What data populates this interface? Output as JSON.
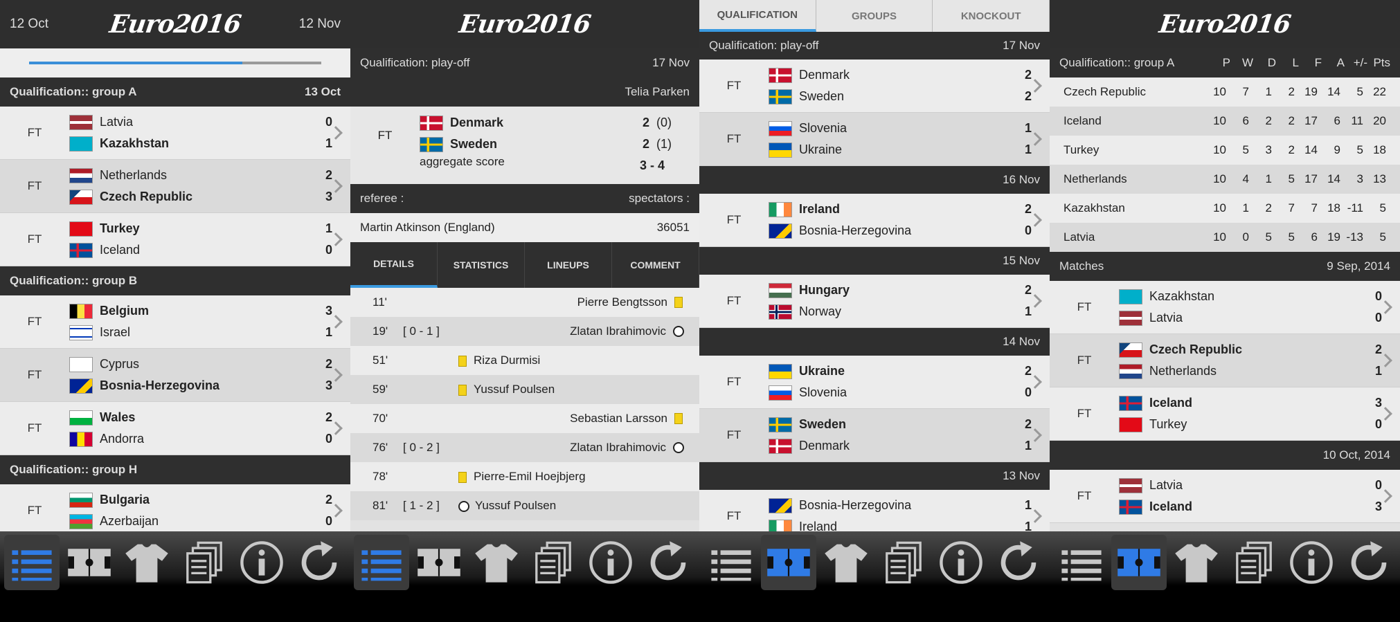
{
  "app": {
    "title": "Euro2016"
  },
  "colors": {
    "accent": "#3a9ae0",
    "active_icon": "#2f7be6",
    "icon": "#c8c8c8",
    "dark": "#2f2f2f"
  },
  "panel1": {
    "prev_date": "12 Oct",
    "next_date": "12 Nov",
    "progress": 0.73,
    "sections": [
      {
        "title": "Qualification:: group A",
        "date": "13 Oct",
        "matches": [
          {
            "status": "FT",
            "home": "Latvia",
            "away": "Kazakhstan",
            "hs": "0",
            "as": "1",
            "winner": "away",
            "hflag": "latvia",
            "aflag": "kazakhstan"
          },
          {
            "status": "FT",
            "home": "Netherlands",
            "away": "Czech Republic",
            "hs": "2",
            "as": "3",
            "winner": "away",
            "hflag": "netherlands",
            "aflag": "czech"
          },
          {
            "status": "FT",
            "home": "Turkey",
            "away": "Iceland",
            "hs": "1",
            "as": "0",
            "winner": "home",
            "hflag": "turkey",
            "aflag": "iceland"
          }
        ]
      },
      {
        "title": "Qualification:: group B",
        "date": "",
        "matches": [
          {
            "status": "FT",
            "home": "Belgium",
            "away": "Israel",
            "hs": "3",
            "as": "1",
            "winner": "home",
            "hflag": "belgium",
            "aflag": "israel"
          },
          {
            "status": "FT",
            "home": "Cyprus",
            "away": "Bosnia-Herzegovina",
            "hs": "2",
            "as": "3",
            "winner": "away",
            "hflag": "cyprus",
            "aflag": "bosnia"
          },
          {
            "status": "FT",
            "home": "Wales",
            "away": "Andorra",
            "hs": "2",
            "as": "0",
            "winner": "home",
            "hflag": "wales",
            "aflag": "andorra"
          }
        ]
      },
      {
        "title": "Qualification:: group H",
        "date": "",
        "matches": [
          {
            "status": "FT",
            "home": "Bulgaria",
            "away": "Azerbaijan",
            "hs": "2",
            "as": "0",
            "winner": "home",
            "hflag": "bulgaria",
            "aflag": "azerbaijan"
          }
        ]
      }
    ]
  },
  "panel2": {
    "competition": "Qualification: play-off",
    "date": "17 Nov",
    "venue": "Telia Parken",
    "status": "FT",
    "home": "Denmark",
    "away": "Sweden",
    "hs": "2",
    "hs_pen": "(0)",
    "as": "2",
    "as_pen": "(1)",
    "agg_label": "aggregate score",
    "agg_value": "3 - 4",
    "referee_label": "referee :",
    "spectators_label": "spectators :",
    "referee": "Martin Atkinson (England)",
    "spectators": "36051",
    "tabs": [
      "DETAILS",
      "STATISTICS",
      "LINEUPS",
      "COMMENT"
    ],
    "events": [
      {
        "min": "11'",
        "score": "",
        "player": "Pierre Bengtsson",
        "side": "right",
        "type": "yellow"
      },
      {
        "min": "19'",
        "score": "[ 0 - 1 ]",
        "player": "Zlatan Ibrahimovic",
        "side": "right",
        "type": "goal"
      },
      {
        "min": "51'",
        "score": "",
        "player": "Riza Durmisi",
        "side": "left",
        "type": "yellow"
      },
      {
        "min": "59'",
        "score": "",
        "player": "Yussuf Poulsen",
        "side": "left",
        "type": "yellow"
      },
      {
        "min": "70'",
        "score": "",
        "player": "Sebastian Larsson",
        "side": "right",
        "type": "yellow"
      },
      {
        "min": "76'",
        "score": "[ 0 - 2 ]",
        "player": "Zlatan Ibrahimovic",
        "side": "right",
        "type": "goal"
      },
      {
        "min": "78'",
        "score": "",
        "player": "Pierre-Emil Hoejbjerg",
        "side": "left",
        "type": "yellow"
      },
      {
        "min": "81'",
        "score": "[ 1 - 2 ]",
        "player": "Yussuf Poulsen",
        "side": "left",
        "type": "goal"
      }
    ]
  },
  "panel3": {
    "tabs": [
      "QUALIFICATION",
      "GROUPS",
      "KNOCKOUT"
    ],
    "days": [
      {
        "title": "Qualification: play-off",
        "date": "17 Nov",
        "matches": [
          {
            "status": "FT",
            "home": "Denmark",
            "away": "Sweden",
            "hs": "2",
            "as": "2",
            "winner": "none",
            "hflag": "denmark",
            "aflag": "sweden"
          },
          {
            "status": "FT",
            "home": "Slovenia",
            "away": "Ukraine",
            "hs": "1",
            "as": "1",
            "winner": "none",
            "hflag": "slovenia",
            "aflag": "ukraine"
          }
        ]
      },
      {
        "title": "",
        "date": "16 Nov",
        "matches": [
          {
            "status": "FT",
            "home": "Ireland",
            "away": "Bosnia-Herzegovina",
            "hs": "2",
            "as": "0",
            "winner": "home",
            "hflag": "ireland",
            "aflag": "bosnia"
          }
        ]
      },
      {
        "title": "",
        "date": "15 Nov",
        "matches": [
          {
            "status": "FT",
            "home": "Hungary",
            "away": "Norway",
            "hs": "2",
            "as": "1",
            "winner": "home",
            "hflag": "hungary",
            "aflag": "norway"
          }
        ]
      },
      {
        "title": "",
        "date": "14 Nov",
        "matches": [
          {
            "status": "FT",
            "home": "Ukraine",
            "away": "Slovenia",
            "hs": "2",
            "as": "0",
            "winner": "home",
            "hflag": "ukraine",
            "aflag": "slovenia"
          },
          {
            "status": "FT",
            "home": "Sweden",
            "away": "Denmark",
            "hs": "2",
            "as": "1",
            "winner": "home",
            "hflag": "sweden",
            "aflag": "denmark"
          }
        ]
      },
      {
        "title": "",
        "date": "13 Nov",
        "matches": [
          {
            "status": "FT",
            "home": "Bosnia-Herzegovina",
            "away": "Ireland",
            "hs": "1",
            "as": "1",
            "winner": "none",
            "hflag": "bosnia",
            "aflag": "ireland"
          }
        ]
      }
    ]
  },
  "panel4": {
    "group_title": "Qualification:: group A",
    "cols": [
      "P",
      "W",
      "D",
      "L",
      "F",
      "A",
      "+/-",
      "Pts"
    ],
    "standings": [
      {
        "team": "Czech Republic",
        "v": [
          "10",
          "7",
          "1",
          "2",
          "19",
          "14",
          "5",
          "22"
        ]
      },
      {
        "team": "Iceland",
        "v": [
          "10",
          "6",
          "2",
          "2",
          "17",
          "6",
          "11",
          "20"
        ]
      },
      {
        "team": "Turkey",
        "v": [
          "10",
          "5",
          "3",
          "2",
          "14",
          "9",
          "5",
          "18"
        ]
      },
      {
        "team": "Netherlands",
        "v": [
          "10",
          "4",
          "1",
          "5",
          "17",
          "14",
          "3",
          "13"
        ]
      },
      {
        "team": "Kazakhstan",
        "v": [
          "10",
          "1",
          "2",
          "7",
          "7",
          "18",
          "-11",
          "5"
        ]
      },
      {
        "team": "Latvia",
        "v": [
          "10",
          "0",
          "5",
          "5",
          "6",
          "19",
          "-13",
          "5"
        ]
      }
    ],
    "matches_label": "Matches",
    "matches_date": "9 Sep, 2014",
    "matches": [
      {
        "status": "FT",
        "home": "Kazakhstan",
        "away": "Latvia",
        "hs": "0",
        "as": "0",
        "winner": "none",
        "hflag": "kazakhstan",
        "aflag": "latvia"
      },
      {
        "status": "FT",
        "home": "Czech Republic",
        "away": "Netherlands",
        "hs": "2",
        "as": "1",
        "winner": "home",
        "hflag": "czech",
        "aflag": "netherlands"
      },
      {
        "status": "FT",
        "home": "Iceland",
        "away": "Turkey",
        "hs": "3",
        "as": "0",
        "winner": "home",
        "hflag": "iceland",
        "aflag": "turkey"
      }
    ],
    "date2": "10 Oct, 2014",
    "matches2": [
      {
        "status": "FT",
        "home": "Latvia",
        "away": "Iceland",
        "hs": "0",
        "as": "3",
        "winner": "away",
        "hflag": "latvia",
        "aflag": "iceland"
      }
    ]
  },
  "nav": {
    "icons": [
      "list-icon",
      "pitch-icon",
      "shirt-icon",
      "documents-icon",
      "info-icon",
      "refresh-icon"
    ],
    "active": [
      0,
      0,
      1,
      1
    ]
  }
}
